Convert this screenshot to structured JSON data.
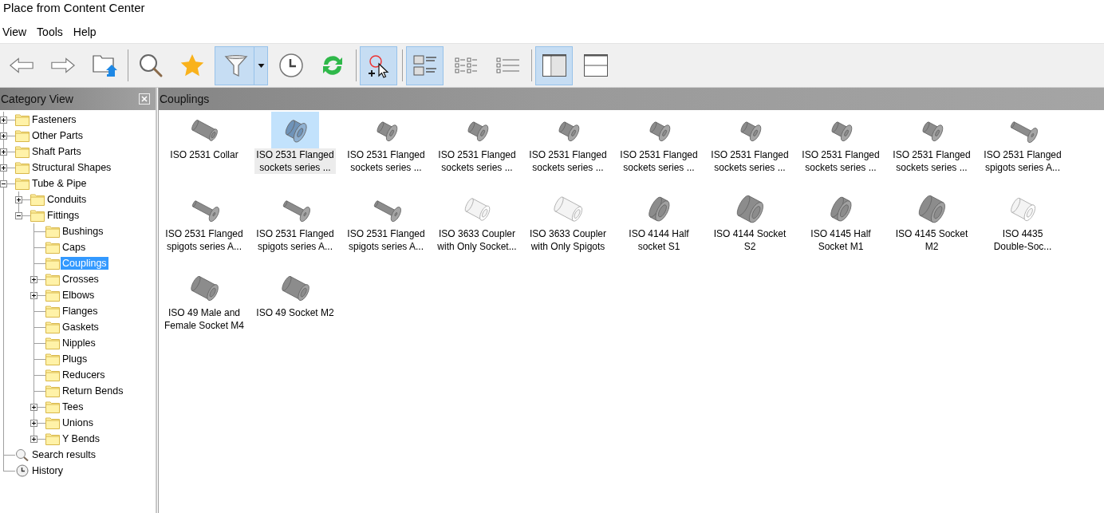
{
  "window": {
    "title": "Place from Content Center"
  },
  "menu": [
    "View",
    "Tools",
    "Help"
  ],
  "toolbar": [
    {
      "kind": "back",
      "selected": false
    },
    {
      "kind": "forward",
      "selected": false
    },
    {
      "kind": "folder-up",
      "selected": false
    },
    {
      "kind": "separator"
    },
    {
      "kind": "search",
      "selected": false
    },
    {
      "kind": "favorite",
      "selected": false
    },
    {
      "kind": "filter",
      "selected": true
    },
    {
      "kind": "history",
      "selected": false
    },
    {
      "kind": "refresh",
      "selected": false
    },
    {
      "kind": "separator"
    },
    {
      "kind": "pick",
      "selected": true
    },
    {
      "kind": "separator"
    },
    {
      "kind": "large-icons",
      "selected": true
    },
    {
      "kind": "small-icons",
      "selected": false
    },
    {
      "kind": "list",
      "selected": false
    },
    {
      "kind": "separator"
    },
    {
      "kind": "split-vertical",
      "selected": true
    },
    {
      "kind": "split-horizontal",
      "selected": false
    }
  ],
  "category_panel": {
    "title": "Category View"
  },
  "tree": [
    {
      "label": "Fasteners",
      "kind": "folder",
      "expanded": false,
      "selected": false,
      "has_children": true
    },
    {
      "label": "Other Parts",
      "kind": "folder",
      "expanded": false,
      "selected": false,
      "has_children": true
    },
    {
      "label": "Shaft Parts",
      "kind": "folder",
      "expanded": false,
      "selected": false,
      "has_children": true
    },
    {
      "label": "Structural Shapes",
      "kind": "folder",
      "expanded": false,
      "selected": false,
      "has_children": true
    },
    {
      "label": "Tube & Pipe",
      "kind": "folder",
      "expanded": true,
      "selected": false,
      "has_children": true,
      "children": [
        {
          "label": "Conduits",
          "kind": "folder",
          "expanded": false,
          "selected": false,
          "has_children": true
        },
        {
          "label": "Fittings",
          "kind": "folder",
          "expanded": true,
          "selected": false,
          "has_children": true,
          "children": [
            {
              "label": "Bushings",
              "kind": "folder",
              "selected": false,
              "has_children": false
            },
            {
              "label": "Caps",
              "kind": "folder",
              "selected": false,
              "has_children": false
            },
            {
              "label": "Couplings",
              "kind": "folder",
              "selected": true,
              "has_children": false
            },
            {
              "label": "Crosses",
              "kind": "folder",
              "expanded": false,
              "selected": false,
              "has_children": true
            },
            {
              "label": "Elbows",
              "kind": "folder",
              "expanded": false,
              "selected": false,
              "has_children": true
            },
            {
              "label": "Flanges",
              "kind": "folder",
              "selected": false,
              "has_children": false
            },
            {
              "label": "Gaskets",
              "kind": "folder",
              "selected": false,
              "has_children": false
            },
            {
              "label": "Nipples",
              "kind": "folder",
              "selected": false,
              "has_children": false
            },
            {
              "label": "Plugs",
              "kind": "folder",
              "selected": false,
              "has_children": false
            },
            {
              "label": "Reducers",
              "kind": "folder",
              "selected": false,
              "has_children": false
            },
            {
              "label": "Return Bends",
              "kind": "folder",
              "selected": false,
              "has_children": false
            },
            {
              "label": "Tees",
              "kind": "folder",
              "expanded": false,
              "selected": false,
              "has_children": true
            },
            {
              "label": "Unions",
              "kind": "folder",
              "expanded": false,
              "selected": false,
              "has_children": true
            },
            {
              "label": "Y Bends",
              "kind": "folder",
              "expanded": false,
              "selected": false,
              "has_children": true
            }
          ]
        }
      ]
    },
    {
      "label": "Search results",
      "kind": "search",
      "selected": false,
      "has_children": false
    },
    {
      "label": "History",
      "kind": "history",
      "selected": false,
      "has_children": false
    }
  ],
  "content": {
    "title": "Couplings"
  },
  "parts": [
    {
      "lines": [
        "ISO 2531 Collar"
      ],
      "kind": "collar",
      "selected": false
    },
    {
      "lines": [
        "ISO 2531 Flanged",
        "sockets series ..."
      ],
      "kind": "flanged-socket-short",
      "selected": true
    },
    {
      "lines": [
        "ISO 2531 Flanged",
        "sockets series ..."
      ],
      "kind": "flanged-socket",
      "selected": false
    },
    {
      "lines": [
        "ISO 2531 Flanged",
        "sockets series ..."
      ],
      "kind": "flanged-socket",
      "selected": false
    },
    {
      "lines": [
        "ISO 2531 Flanged",
        "sockets series ..."
      ],
      "kind": "flanged-socket",
      "selected": false
    },
    {
      "lines": [
        "ISO 2531 Flanged",
        "sockets series ..."
      ],
      "kind": "flanged-socket",
      "selected": false
    },
    {
      "lines": [
        "ISO 2531 Flanged",
        "sockets series ..."
      ],
      "kind": "flanged-socket",
      "selected": false
    },
    {
      "lines": [
        "ISO 2531 Flanged",
        "sockets series ..."
      ],
      "kind": "flanged-socket",
      "selected": false
    },
    {
      "lines": [
        "ISO 2531 Flanged",
        "sockets series ..."
      ],
      "kind": "flanged-socket",
      "selected": false
    },
    {
      "lines": [
        "ISO 2531 Flanged",
        "spigots series A..."
      ],
      "kind": "flanged-spigot",
      "selected": false
    },
    {
      "lines": [
        "ISO 2531 Flanged",
        "spigots series A..."
      ],
      "kind": "flanged-spigot",
      "selected": false
    },
    {
      "lines": [
        "ISO 2531 Flanged",
        "spigots series A..."
      ],
      "kind": "flanged-spigot",
      "selected": false
    },
    {
      "lines": [
        "ISO 2531 Flanged",
        "spigots series A..."
      ],
      "kind": "flanged-spigot",
      "selected": false
    },
    {
      "lines": [
        "ISO 3633 Coupler",
        "with Only Socket..."
      ],
      "kind": "white-coupler",
      "selected": false
    },
    {
      "lines": [
        "ISO 3633 Coupler",
        "with Only Spigots"
      ],
      "kind": "white-pipe",
      "selected": false
    },
    {
      "lines": [
        "ISO 4144 Half",
        "socket S1"
      ],
      "kind": "half-socket",
      "selected": false
    },
    {
      "lines": [
        "ISO 4144 Socket",
        "S2"
      ],
      "kind": "socket",
      "selected": false
    },
    {
      "lines": [
        "ISO 4145 Half",
        "Socket M1"
      ],
      "kind": "half-socket",
      "selected": false
    },
    {
      "lines": [
        "ISO 4145 Socket",
        "M2"
      ],
      "kind": "socket",
      "selected": false
    },
    {
      "lines": [
        "ISO 4435",
        "Double-Soc..."
      ],
      "kind": "white-double",
      "selected": false
    },
    {
      "lines": [
        "ISO 49 Male and",
        "Female Socket M4"
      ],
      "kind": "threaded-socket",
      "selected": false
    },
    {
      "lines": [
        "ISO 49 Socket M2"
      ],
      "kind": "threaded-socket",
      "selected": false
    }
  ]
}
